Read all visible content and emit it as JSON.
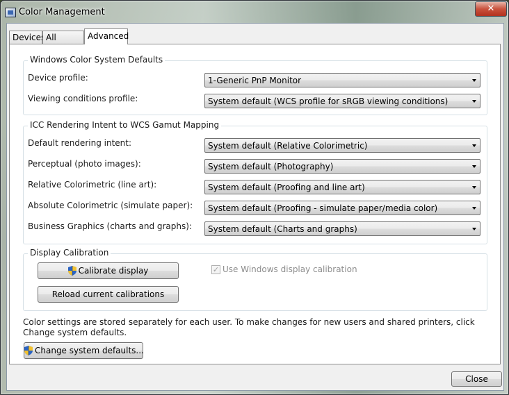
{
  "window": {
    "title": "Color Management",
    "close_glyph": "✕"
  },
  "tabs": [
    {
      "label": "Devices"
    },
    {
      "label": "All Profiles"
    },
    {
      "label": "Advanced"
    }
  ],
  "wcs_defaults": {
    "legend": "Windows Color System Defaults",
    "device_profile": {
      "label": "Device profile:",
      "value": "1-Generic PnP Monitor"
    },
    "viewing_conditions": {
      "label": "Viewing conditions profile:",
      "value": "System default (WCS profile for sRGB viewing conditions)"
    }
  },
  "icc_mapping": {
    "legend": "ICC Rendering Intent to WCS Gamut Mapping",
    "rows": [
      {
        "label": "Default rendering intent:",
        "value": "System default (Relative Colorimetric)"
      },
      {
        "label": "Perceptual (photo images):",
        "value": "System default (Photography)"
      },
      {
        "label": "Relative Colorimetric (line art):",
        "value": "System default (Proofing and line art)"
      },
      {
        "label": "Absolute Colorimetric (simulate paper):",
        "value": "System default (Proofing - simulate paper/media color)"
      },
      {
        "label": "Business Graphics (charts and graphs):",
        "value": "System default (Charts and graphs)"
      }
    ]
  },
  "display_calibration": {
    "legend": "Display Calibration",
    "calibrate_label": "Calibrate display",
    "reload_label": "Reload current calibrations",
    "use_windows_label": "Use Windows display calibration",
    "use_windows_checked": "✓"
  },
  "footer": {
    "note": "Color settings are stored separately for each user. To make changes for new users and shared printers, click Change system defaults.",
    "change_defaults_label": "Change system defaults...",
    "close_label": "Close"
  },
  "icons": {
    "app": "color-management-icon",
    "shield": "uac-shield-icon",
    "dropdown": "chevron-down-icon"
  }
}
